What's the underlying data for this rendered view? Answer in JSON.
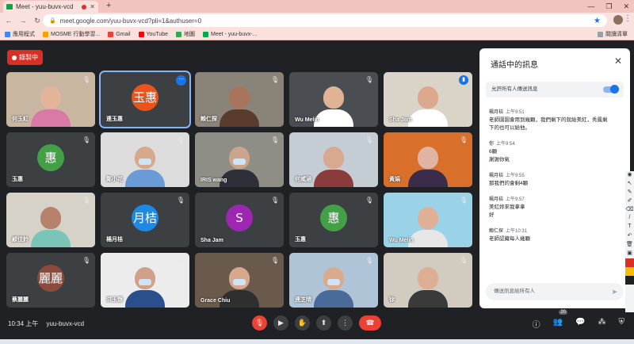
{
  "browser": {
    "tab_title": "Meet - yuu-buvx-vcd",
    "new_tab": "+",
    "url": "meet.google.com/yuu-buvx-vcd?pli=1&authuser=0",
    "bookmarks": [
      "應用程式",
      "MOSME 行動學習...",
      "Gmail",
      "YouTube",
      "地圖",
      "Meet - yuu-buvx-..."
    ],
    "reading_list": "閱讀清單"
  },
  "meeting": {
    "recording_label": "錄製中",
    "time": "10:34 上午",
    "code": "yuu-buvx-vcd",
    "participant_count": "20"
  },
  "tiles": [
    {
      "name": "何玉紅",
      "kind": "photo",
      "bg": "#c9b6a0",
      "skin": "#e2b49a",
      "shirt": "#d97aa6"
    },
    {
      "name": "連玉惠",
      "kind": "avatar",
      "avatar_text": "玉惠",
      "avatar_color": "#e8541c",
      "selected": true
    },
    {
      "name": "賴仁探",
      "kind": "photo",
      "bg": "#8a8378",
      "skin": "#a8755c",
      "shirt": "#5a3c2c"
    },
    {
      "name": "Wu Melin",
      "kind": "photo",
      "bg": "#4a4d52",
      "skin": "#e0b394",
      "shirt": "#ffffff"
    },
    {
      "name": "Sha Jam",
      "kind": "photo",
      "bg": "#d9d3c8",
      "skin": "#dba88e",
      "shirt": "#ffffff",
      "speaking": true
    },
    {
      "name": "玉惠",
      "kind": "avatar",
      "avatar_text": "惠",
      "avatar_color": "#43a047"
    },
    {
      "name": "鄭小花",
      "kind": "photo",
      "bg": "#dcdcdc",
      "skin": "#d6a88c",
      "shirt": "#6a9bd6",
      "masked": true
    },
    {
      "name": "IRIS wang",
      "kind": "photo",
      "bg": "#8e8e86",
      "skin": "#c9a58c",
      "shirt": "#2f2f3a",
      "masked": true
    },
    {
      "name": "何咸涵",
      "kind": "photo",
      "bg": "#c4ccd4",
      "skin": "#d8a890",
      "shirt": "#8a3b3b"
    },
    {
      "name": "黃娟",
      "kind": "photo",
      "bg": "#d8702c",
      "skin": "#e0b4a0",
      "shirt": "#3b2d4a"
    },
    {
      "name": "顧佳鈴",
      "kind": "photo",
      "bg": "#d6d2c8",
      "skin": "#b7826c",
      "shirt": "#7bc4b8"
    },
    {
      "name": "楊月桔",
      "kind": "avatar",
      "avatar_text": "月桔",
      "avatar_color": "#1e88e5"
    },
    {
      "name": "Sha Jam",
      "kind": "avatar",
      "avatar_text": "S",
      "avatar_color": "#9c27b0"
    },
    {
      "name": "玉惠",
      "kind": "avatar",
      "avatar_text": "惠",
      "avatar_color": "#43a047"
    },
    {
      "name": "Wu Melin",
      "kind": "photo",
      "bg": "#9ad2e8",
      "skin": "#e0b096",
      "shirt": "#e6e6e6"
    },
    {
      "name": "蔡麗麗",
      "kind": "avatar",
      "avatar_text": "麗麗",
      "avatar_color": "#8d4a3a"
    },
    {
      "name": "洪玉靜",
      "kind": "photo",
      "bg": "#ececec",
      "skin": "#d0a088",
      "shirt": "#2a4f8a",
      "masked": true
    },
    {
      "name": "Grace Chiu",
      "kind": "photo",
      "bg": "#6a5a4c",
      "skin": "#d6a88e",
      "shirt": "#2f2f2f",
      "masked": true
    },
    {
      "name": "連芝晴",
      "kind": "photo",
      "bg": "#b0c4d8",
      "skin": "#d9aa8c",
      "shirt": "#4a6a9a",
      "masked": true
    },
    {
      "name": "徐",
      "kind": "photo",
      "bg": "#d2ccc0",
      "skin": "#dcae94",
      "shirt": "#3a3a3a"
    }
  ],
  "chat": {
    "title": "通話中的訊息",
    "allow_label": "允許所有人傳送訊息",
    "input_placeholder": "傳送訊息給所有人",
    "messages": [
      {
        "sender": "楊月桔",
        "time": "上午9:51",
        "lines": [
          "老師園園會用到幾顆，我們剩下的就給美紅，秀鳳剩",
          "下的也可以給他。"
        ]
      },
      {
        "sender": "你",
        "time": "上午9:54",
        "lines": [
          "6顆",
          "謝謝你氣"
        ]
      },
      {
        "sender": "楊月桔",
        "time": "上午9:55",
        "lines": [
          "那我們的會剩4顆"
        ]
      },
      {
        "sender": "楊月桔",
        "time": "上午9:57",
        "lines": [
          "美紅妳來我拿拿",
          "好"
        ]
      },
      {
        "sender": "賴仁探",
        "time": "上午10:31",
        "lines": [
          "老師認藏每人幾顆"
        ]
      }
    ]
  }
}
